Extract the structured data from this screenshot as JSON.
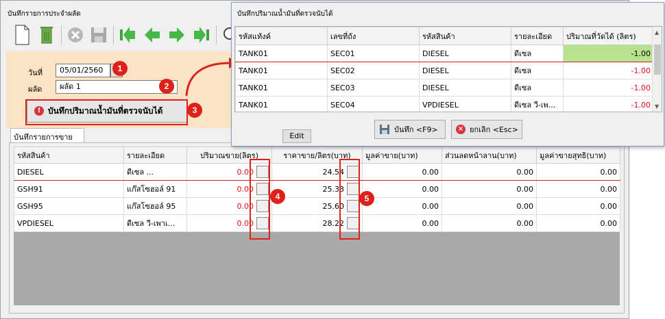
{
  "main": {
    "title": "บันทึกรายการประจำผลัด",
    "form": {
      "date_label": "วันที่",
      "date_value": "05/01/2560",
      "shift_label": "ผลัด",
      "shift_value": "ผลัด 1",
      "record_button": "บันทึกปริมาณน้ำมันที่ตรวจนับได้"
    },
    "tab": "บันทึกรายการขาย",
    "sales_table": {
      "headers": [
        "รหัสสินค้า",
        "รายละเอียด",
        "ปริมาณขาย(ลิตร)",
        "ราคาขาย/ลิตร(บาท)",
        "มูลค่าขาย(บาท)",
        "ส่วนลดหน้าลาน(บาท)",
        "มูลค่าขายสุทธิ(บาท)"
      ],
      "rows": [
        {
          "code": "DIESEL",
          "desc": "ดีเซล           ...",
          "qty": "0.00",
          "price": "24.54",
          "value": "0.00",
          "discount": "0.00",
          "net": "0.00"
        },
        {
          "code": "GSH91",
          "desc": "แก๊สโซฮอล์ 91",
          "qty": "0.00",
          "price": "25.33",
          "value": "0.00",
          "discount": "0.00",
          "net": "0.00"
        },
        {
          "code": "GSH95",
          "desc": "แก๊สโซฮอล์ 95",
          "qty": "0.00",
          "price": "25.60",
          "value": "0.00",
          "discount": "0.00",
          "net": "0.00"
        },
        {
          "code": "VPDIESEL",
          "desc": "ดีเซล วี-เพาเ...",
          "qty": "0.00",
          "price": "28.22",
          "value": "0.00",
          "discount": "0.00",
          "net": "0.00"
        }
      ]
    }
  },
  "dialog": {
    "title": "บันทึกปริมาณน้ำมันที่ตรวจนับได้",
    "headers": [
      "รหัสแท้งค์",
      "เลขที่ถัง",
      "รหัสสินค้า",
      "รายละเอียด",
      "ปริมาณที่วัดได้ (ลิตร)"
    ],
    "rows": [
      {
        "tank": "TANK01",
        "sec": "SEC01",
        "code": "DIESEL",
        "desc": "ดีเซล",
        "qty": "-1.00"
      },
      {
        "tank": "TANK01",
        "sec": "SEC02",
        "code": "DIESEL",
        "desc": "ดีเซล",
        "qty": "-1.00"
      },
      {
        "tank": "TANK01",
        "sec": "SEC03",
        "code": "DIESEL",
        "desc": "ดีเซล",
        "qty": "-1.00"
      },
      {
        "tank": "TANK01",
        "sec": "SEC04",
        "code": "VPDIESEL",
        "desc": "ดีเซล วี-เพ...",
        "qty": "-1.00"
      }
    ],
    "edit_button": "Edit",
    "save_button": "บันทึก <F9>",
    "cancel_button": "ยกเลิก <Esc>"
  },
  "callouts": [
    "1",
    "2",
    "3",
    "4",
    "5"
  ],
  "colors": {
    "accent_red": "#e0201a",
    "panel_peach": "#fbe4c6",
    "edit_green": "#b7e38e"
  },
  "toolbar_icons": [
    "new-document-icon",
    "trash-icon",
    "cancel-icon",
    "save-icon",
    "first-icon",
    "previous-icon",
    "next-icon",
    "last-icon",
    "search-icon"
  ]
}
